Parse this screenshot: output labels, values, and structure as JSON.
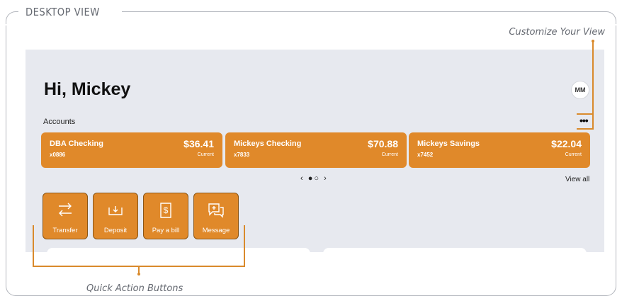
{
  "frame": {
    "view_label": "DESKTOP VIEW",
    "annotation_customize": "Customize Your View",
    "annotation_quick_actions": "Quick Action Buttons"
  },
  "header": {
    "greeting": "Hi, Mickey",
    "avatar_initials": "MM"
  },
  "accounts": {
    "label": "Accounts",
    "more_label": "•••",
    "view_all": "View all",
    "pager": "‹ ●○ ›",
    "items": [
      {
        "name": "DBA Checking",
        "number": "x0886",
        "amount": "$36.41",
        "status": "Current"
      },
      {
        "name": "Mickeys Checking",
        "number": "x7833",
        "amount": "$70.88",
        "status": "Current"
      },
      {
        "name": "Mickeys Savings",
        "number": "x7452",
        "amount": "$22.04",
        "status": "Current"
      }
    ]
  },
  "quick_actions": [
    {
      "label": "Transfer",
      "icon": "transfer-icon"
    },
    {
      "label": "Deposit",
      "icon": "deposit-icon"
    },
    {
      "label": "Pay a bill",
      "icon": "bill-icon"
    },
    {
      "label": "Message",
      "icon": "message-icon"
    }
  ],
  "colors": {
    "accent": "#e0892a",
    "background": "#e7e9ef",
    "annotation_line": "#d98a2c"
  }
}
